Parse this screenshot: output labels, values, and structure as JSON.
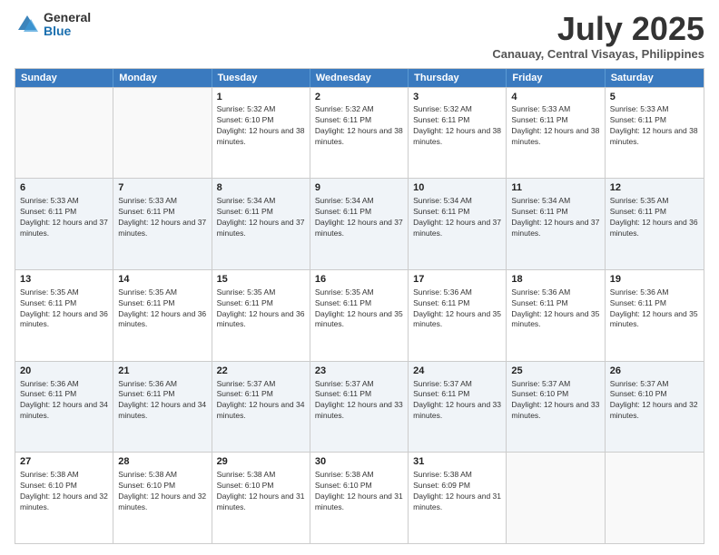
{
  "logo": {
    "general": "General",
    "blue": "Blue"
  },
  "header": {
    "title": "July 2025",
    "subtitle": "Canauay, Central Visayas, Philippines"
  },
  "weekdays": [
    "Sunday",
    "Monday",
    "Tuesday",
    "Wednesday",
    "Thursday",
    "Friday",
    "Saturday"
  ],
  "rows": [
    [
      {
        "day": "",
        "empty": true
      },
      {
        "day": "",
        "empty": true
      },
      {
        "day": "1",
        "sunrise": "Sunrise: 5:32 AM",
        "sunset": "Sunset: 6:10 PM",
        "daylight": "Daylight: 12 hours and 38 minutes."
      },
      {
        "day": "2",
        "sunrise": "Sunrise: 5:32 AM",
        "sunset": "Sunset: 6:11 PM",
        "daylight": "Daylight: 12 hours and 38 minutes."
      },
      {
        "day": "3",
        "sunrise": "Sunrise: 5:32 AM",
        "sunset": "Sunset: 6:11 PM",
        "daylight": "Daylight: 12 hours and 38 minutes."
      },
      {
        "day": "4",
        "sunrise": "Sunrise: 5:33 AM",
        "sunset": "Sunset: 6:11 PM",
        "daylight": "Daylight: 12 hours and 38 minutes."
      },
      {
        "day": "5",
        "sunrise": "Sunrise: 5:33 AM",
        "sunset": "Sunset: 6:11 PM",
        "daylight": "Daylight: 12 hours and 38 minutes."
      }
    ],
    [
      {
        "day": "6",
        "sunrise": "Sunrise: 5:33 AM",
        "sunset": "Sunset: 6:11 PM",
        "daylight": "Daylight: 12 hours and 37 minutes."
      },
      {
        "day": "7",
        "sunrise": "Sunrise: 5:33 AM",
        "sunset": "Sunset: 6:11 PM",
        "daylight": "Daylight: 12 hours and 37 minutes."
      },
      {
        "day": "8",
        "sunrise": "Sunrise: 5:34 AM",
        "sunset": "Sunset: 6:11 PM",
        "daylight": "Daylight: 12 hours and 37 minutes."
      },
      {
        "day": "9",
        "sunrise": "Sunrise: 5:34 AM",
        "sunset": "Sunset: 6:11 PM",
        "daylight": "Daylight: 12 hours and 37 minutes."
      },
      {
        "day": "10",
        "sunrise": "Sunrise: 5:34 AM",
        "sunset": "Sunset: 6:11 PM",
        "daylight": "Daylight: 12 hours and 37 minutes."
      },
      {
        "day": "11",
        "sunrise": "Sunrise: 5:34 AM",
        "sunset": "Sunset: 6:11 PM",
        "daylight": "Daylight: 12 hours and 37 minutes."
      },
      {
        "day": "12",
        "sunrise": "Sunrise: 5:35 AM",
        "sunset": "Sunset: 6:11 PM",
        "daylight": "Daylight: 12 hours and 36 minutes."
      }
    ],
    [
      {
        "day": "13",
        "sunrise": "Sunrise: 5:35 AM",
        "sunset": "Sunset: 6:11 PM",
        "daylight": "Daylight: 12 hours and 36 minutes."
      },
      {
        "day": "14",
        "sunrise": "Sunrise: 5:35 AM",
        "sunset": "Sunset: 6:11 PM",
        "daylight": "Daylight: 12 hours and 36 minutes."
      },
      {
        "day": "15",
        "sunrise": "Sunrise: 5:35 AM",
        "sunset": "Sunset: 6:11 PM",
        "daylight": "Daylight: 12 hours and 36 minutes."
      },
      {
        "day": "16",
        "sunrise": "Sunrise: 5:35 AM",
        "sunset": "Sunset: 6:11 PM",
        "daylight": "Daylight: 12 hours and 35 minutes."
      },
      {
        "day": "17",
        "sunrise": "Sunrise: 5:36 AM",
        "sunset": "Sunset: 6:11 PM",
        "daylight": "Daylight: 12 hours and 35 minutes."
      },
      {
        "day": "18",
        "sunrise": "Sunrise: 5:36 AM",
        "sunset": "Sunset: 6:11 PM",
        "daylight": "Daylight: 12 hours and 35 minutes."
      },
      {
        "day": "19",
        "sunrise": "Sunrise: 5:36 AM",
        "sunset": "Sunset: 6:11 PM",
        "daylight": "Daylight: 12 hours and 35 minutes."
      }
    ],
    [
      {
        "day": "20",
        "sunrise": "Sunrise: 5:36 AM",
        "sunset": "Sunset: 6:11 PM",
        "daylight": "Daylight: 12 hours and 34 minutes."
      },
      {
        "day": "21",
        "sunrise": "Sunrise: 5:36 AM",
        "sunset": "Sunset: 6:11 PM",
        "daylight": "Daylight: 12 hours and 34 minutes."
      },
      {
        "day": "22",
        "sunrise": "Sunrise: 5:37 AM",
        "sunset": "Sunset: 6:11 PM",
        "daylight": "Daylight: 12 hours and 34 minutes."
      },
      {
        "day": "23",
        "sunrise": "Sunrise: 5:37 AM",
        "sunset": "Sunset: 6:11 PM",
        "daylight": "Daylight: 12 hours and 33 minutes."
      },
      {
        "day": "24",
        "sunrise": "Sunrise: 5:37 AM",
        "sunset": "Sunset: 6:11 PM",
        "daylight": "Daylight: 12 hours and 33 minutes."
      },
      {
        "day": "25",
        "sunrise": "Sunrise: 5:37 AM",
        "sunset": "Sunset: 6:10 PM",
        "daylight": "Daylight: 12 hours and 33 minutes."
      },
      {
        "day": "26",
        "sunrise": "Sunrise: 5:37 AM",
        "sunset": "Sunset: 6:10 PM",
        "daylight": "Daylight: 12 hours and 32 minutes."
      }
    ],
    [
      {
        "day": "27",
        "sunrise": "Sunrise: 5:38 AM",
        "sunset": "Sunset: 6:10 PM",
        "daylight": "Daylight: 12 hours and 32 minutes."
      },
      {
        "day": "28",
        "sunrise": "Sunrise: 5:38 AM",
        "sunset": "Sunset: 6:10 PM",
        "daylight": "Daylight: 12 hours and 32 minutes."
      },
      {
        "day": "29",
        "sunrise": "Sunrise: 5:38 AM",
        "sunset": "Sunset: 6:10 PM",
        "daylight": "Daylight: 12 hours and 31 minutes."
      },
      {
        "day": "30",
        "sunrise": "Sunrise: 5:38 AM",
        "sunset": "Sunset: 6:10 PM",
        "daylight": "Daylight: 12 hours and 31 minutes."
      },
      {
        "day": "31",
        "sunrise": "Sunrise: 5:38 AM",
        "sunset": "Sunset: 6:09 PM",
        "daylight": "Daylight: 12 hours and 31 minutes."
      },
      {
        "day": "",
        "empty": true
      },
      {
        "day": "",
        "empty": true
      }
    ]
  ]
}
